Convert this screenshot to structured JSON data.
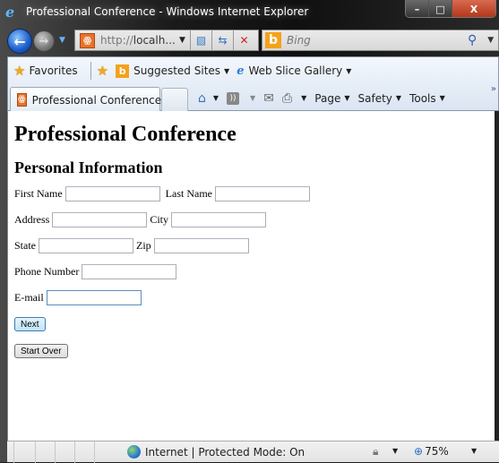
{
  "window": {
    "title": "Professional Conference - Windows Internet Explorer",
    "controls": {
      "minimize": "–",
      "maximize": "□",
      "close": "X"
    }
  },
  "nav": {
    "address_protocol": "http://",
    "address_host": "localh...",
    "search_placeholder": "Bing",
    "icons": {
      "back": "back-arrow",
      "forward": "forward-arrow",
      "compat": "compatibility-view",
      "refresh": "refresh",
      "stop": "stop",
      "search": "magnifier"
    }
  },
  "favorites_bar": {
    "favorites_label": "Favorites",
    "items": [
      {
        "label": "Suggested Sites",
        "icon": "bing-icon"
      },
      {
        "label": "Web Slice Gallery",
        "icon": "ie-icon"
      }
    ]
  },
  "tabs": [
    {
      "label": "Professional Conference",
      "active": true
    }
  ],
  "command_bar": {
    "page_label": "Page",
    "safety_label": "Safety",
    "tools_label": "Tools",
    "more": "»"
  },
  "page": {
    "title": "Professional Conference",
    "section": "Personal Information",
    "fields": {
      "first_name": {
        "label": "First Name",
        "value": ""
      },
      "last_name": {
        "label": "Last Name",
        "value": ""
      },
      "address": {
        "label": "Address",
        "value": ""
      },
      "city": {
        "label": "City",
        "value": ""
      },
      "state": {
        "label": "State",
        "value": ""
      },
      "zip": {
        "label": "Zip",
        "value": ""
      },
      "phone": {
        "label": "Phone Number",
        "value": ""
      },
      "email": {
        "label": "E-mail",
        "value": ""
      }
    },
    "buttons": {
      "next": "Next",
      "start_over": "Start Over"
    }
  },
  "status_bar": {
    "zone_text": "Internet | Protected Mode: On",
    "zoom": "75%"
  }
}
